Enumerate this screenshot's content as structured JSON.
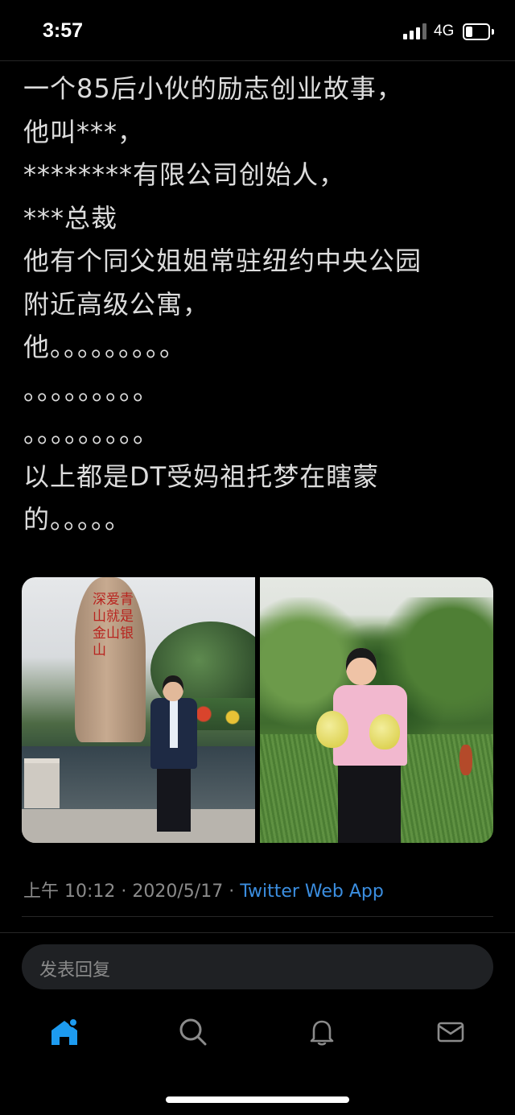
{
  "status_bar": {
    "time": "3:57",
    "network": "4G",
    "battery_level": 0.3
  },
  "tweet": {
    "lines": [
      "一个85后小伙的励志创业故事，",
      "他叫***，",
      "********有限公司创始人，",
      "***总裁",
      "他有个同父姐姐常驻纽约中央公园",
      "附近高级公寓，",
      "他。。。。。。。。。",
      "。。。。。。。。。",
      "。。。。。。。。。",
      "以上都是DT受妈祖托梦在瞎蒙",
      "的。。。。。"
    ],
    "rock_inscription": "深爱青山就是金山银山"
  },
  "meta": {
    "time": "上午 10:12",
    "separator": " · ",
    "date": "2020/5/17",
    "app": "Twitter Web App"
  },
  "reply": {
    "placeholder": "发表回复"
  },
  "tabbar": {
    "icons": [
      "home-icon",
      "search-icon",
      "notifications-icon",
      "messages-icon"
    ],
    "accent": "#1d9bf0",
    "icon_color": "#8b8b8b"
  }
}
